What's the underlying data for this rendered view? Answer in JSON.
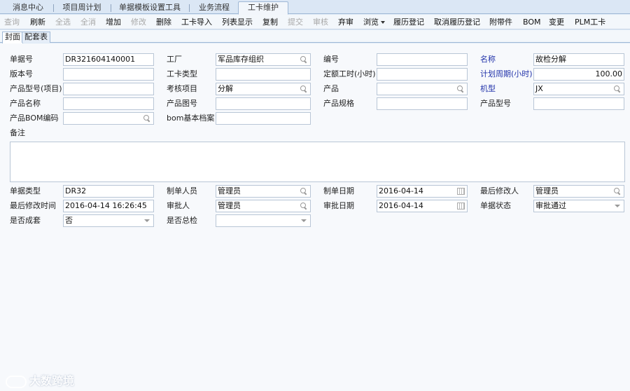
{
  "tabs": [
    {
      "label": "消息中心"
    },
    {
      "label": "项目周计划"
    },
    {
      "label": "单据模板设置工具"
    },
    {
      "label": "业务流程"
    },
    {
      "label": "工卡维护"
    }
  ],
  "toolbar": {
    "query": "查询",
    "refresh": "刷新",
    "select_all": "全选",
    "deselect_all": "全消",
    "add": "增加",
    "edit": "修改",
    "delete": "删除",
    "import": "工卡导入",
    "list_view": "列表显示",
    "copy": "复制",
    "submit": "提交",
    "review": "审核",
    "abandon": "弃审",
    "browse": "浏览",
    "history_register": "履历登记",
    "cancel_history": "取消履历登记",
    "attachment": "附带件",
    "bom": "BOM",
    "change": "变更",
    "plm": "PLM工卡"
  },
  "subtabs": [
    {
      "label": "封面"
    },
    {
      "label": "配套表"
    }
  ],
  "form": {
    "doc_no": {
      "label": "单据号",
      "value": "DR321604140001"
    },
    "factory": {
      "label": "工厂",
      "value": "军品库存组织"
    },
    "code": {
      "label": "编号",
      "value": ""
    },
    "name": {
      "label": "名称",
      "value": "故检分解"
    },
    "version": {
      "label": "版本号",
      "value": ""
    },
    "card_type": {
      "label": "工卡类型",
      "value": ""
    },
    "quota_hours": {
      "label": "定额工时(小时)",
      "value": ""
    },
    "plan_period": {
      "label": "计划周期(小时)",
      "value": "100.00"
    },
    "product_model_item": {
      "label": "产品型号(项目)",
      "value": ""
    },
    "assess_item": {
      "label": "考核项目",
      "value": "分解"
    },
    "product": {
      "label": "产品",
      "value": ""
    },
    "machine_type": {
      "label": "机型",
      "value": "JX"
    },
    "product_name": {
      "label": "产品名称",
      "value": ""
    },
    "product_drawing": {
      "label": "产品图号",
      "value": ""
    },
    "product_spec": {
      "label": "产品规格",
      "value": ""
    },
    "product_model": {
      "label": "产品型号",
      "value": ""
    },
    "product_bom": {
      "label": "产品BOM编码",
      "value": ""
    },
    "bom_archive": {
      "label": "bom基本档案",
      "value": ""
    },
    "remark": {
      "label": "备注",
      "value": ""
    },
    "doc_type": {
      "label": "单据类型",
      "value": "DR32"
    },
    "creator": {
      "label": "制单人员",
      "value": "管理员"
    },
    "create_date": {
      "label": "制单日期",
      "value": "2016-04-14"
    },
    "last_modifier": {
      "label": "最后修改人",
      "value": "管理员"
    },
    "last_modified_time": {
      "label": "最后修改时间",
      "value": "2016-04-14 16:26:45"
    },
    "approver": {
      "label": "审批人",
      "value": "管理员"
    },
    "approve_date": {
      "label": "审批日期",
      "value": "2016-04-14"
    },
    "doc_status": {
      "label": "单据状态",
      "value": "审批通过"
    },
    "is_complete_set": {
      "label": "是否成套",
      "value": "否"
    },
    "is_final_check": {
      "label": "是否总检",
      "value": ""
    }
  },
  "watermark": {
    "text": "大数跨境"
  },
  "colors": {
    "required_label": "#2233aa",
    "background": "#dde9f6"
  }
}
